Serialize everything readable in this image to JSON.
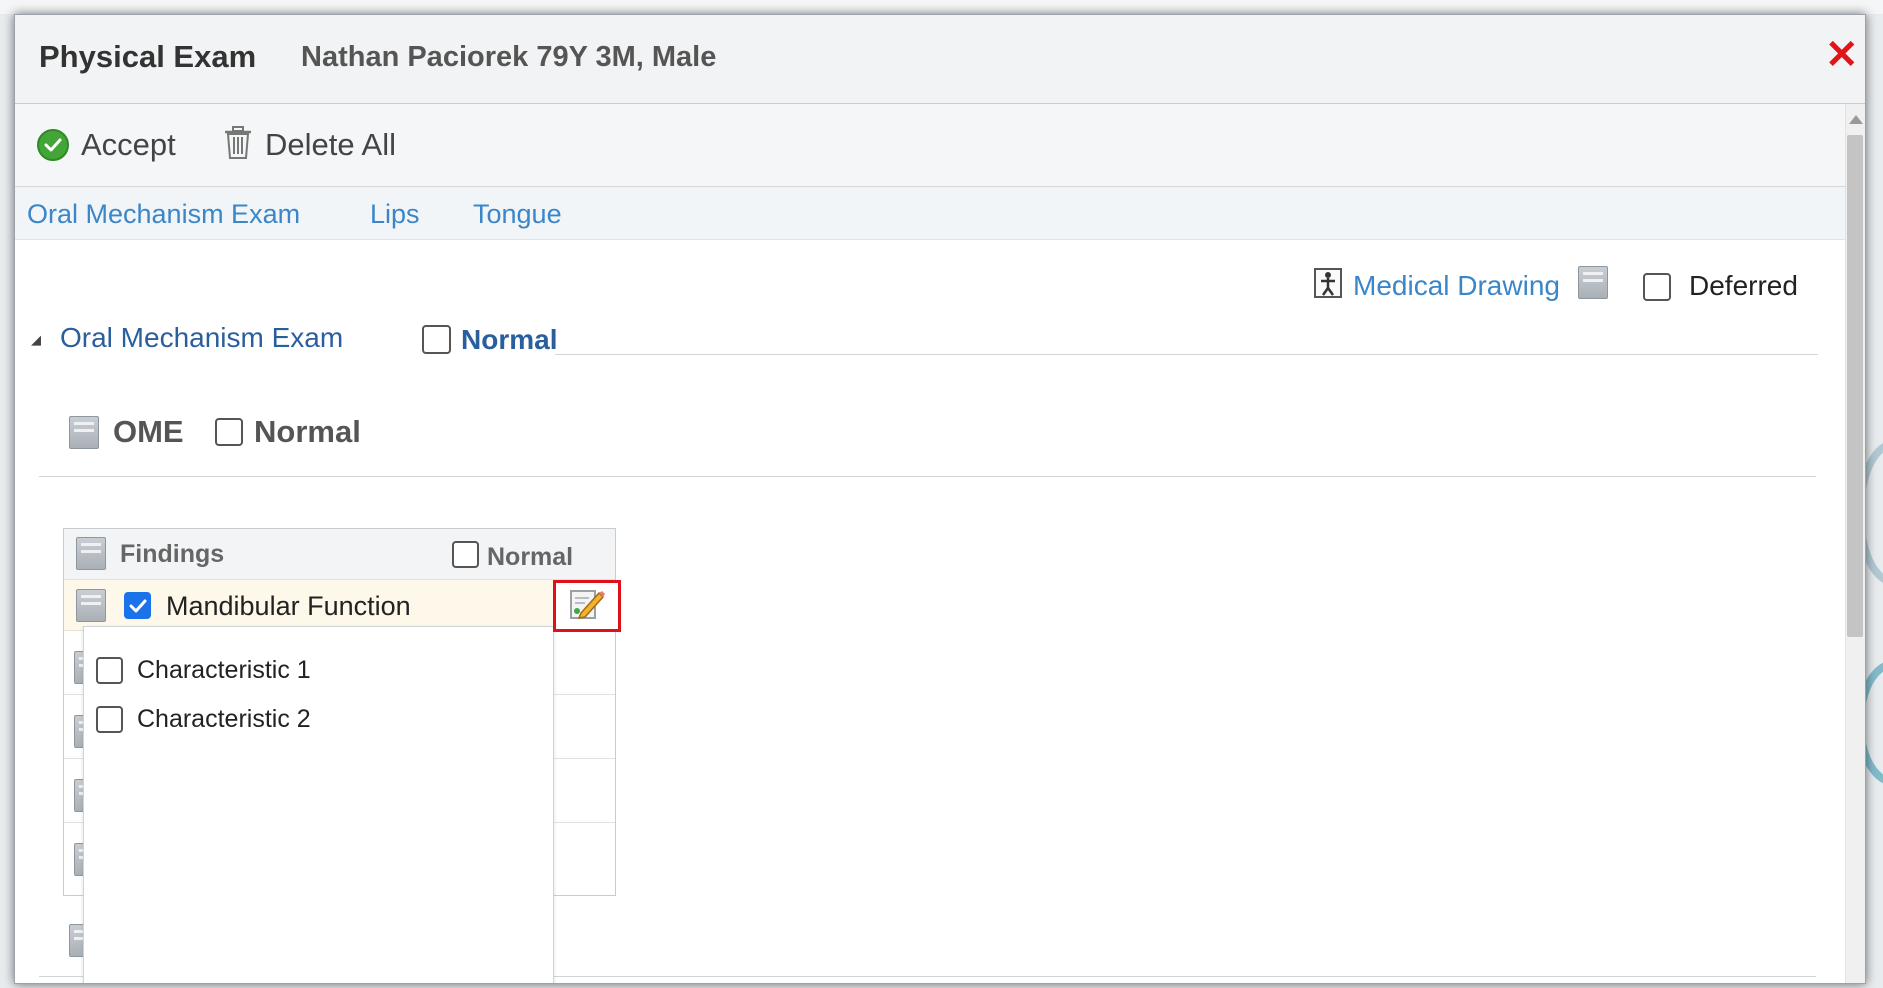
{
  "dialog": {
    "title": "Physical Exam",
    "patient": "Nathan Paciorek 79Y 3M, Male",
    "close_glyph": "✕",
    "close_icon": "close-icon"
  },
  "toolbar": {
    "accept_label": "Accept",
    "delete_all_label": "Delete All",
    "accept_icon": "check-circle-icon",
    "delete_icon": "trash-icon"
  },
  "tabs": [
    {
      "label": "Oral Mechanism Exam"
    },
    {
      "label": "Lips"
    },
    {
      "label": "Tongue"
    }
  ],
  "top_actions": {
    "medical_drawing_label": "Medical Drawing",
    "deferred_label": "Deferred",
    "deferred_checked": false
  },
  "section": {
    "title": "Oral Mechanism Exam",
    "collapse_glyph": "◢",
    "normal_label": "Normal",
    "normal_checked": false
  },
  "ome": {
    "label": "OME",
    "normal_label": "Normal",
    "normal_checked": false
  },
  "findings": {
    "header_label": "Findings",
    "normal_label": "Normal",
    "normal_checked": false,
    "selected_row": {
      "label": "Mandibular Function",
      "checked": true
    },
    "edit_icon": "edit-pencil-icon"
  },
  "popup": {
    "items": [
      {
        "label": "Characteristic 1",
        "checked": false
      },
      {
        "label": "Characteristic 2",
        "checked": false
      }
    ]
  },
  "colors": {
    "link": "#3a86c8",
    "heading": "#2a5f9e",
    "close": "#e3131a",
    "accept": "#43a537",
    "highlight_border": "#e0101a",
    "checkbox_checked": "#1a73e8"
  }
}
